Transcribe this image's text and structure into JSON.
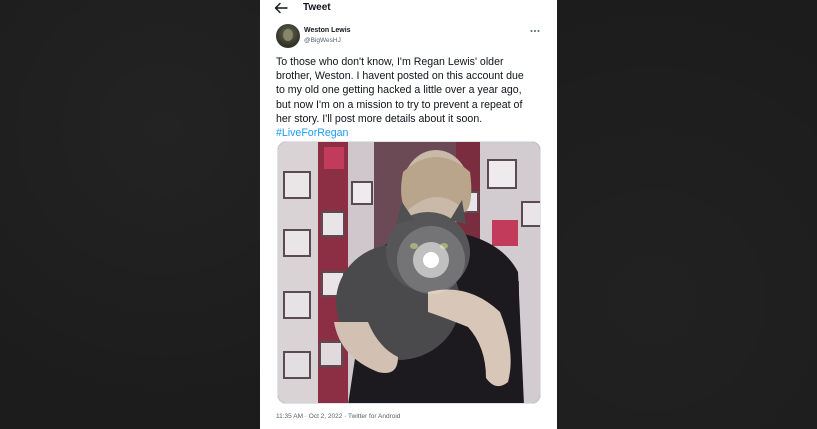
{
  "header": {
    "title": "Tweet",
    "back_icon": "arrow-left-icon"
  },
  "author": {
    "display_name": "Weston Lewis",
    "handle": "@BigWesHJ",
    "more_icon": "more-horizontal-icon"
  },
  "tweet": {
    "text_lines": [
      "To those who don't know, I'm Regan Lewis' older",
      "brother, Weston. I havent posted on this account due",
      "to my old one getting hacked a little over a year ago,",
      "but now I'm on a mission to try to prevent a repeat of",
      "her story. I'll post more details about it soon."
    ],
    "hashtag": "#LiveForRegan"
  },
  "media": {
    "description": "photo-of-girl-holding-cat"
  },
  "meta": {
    "time_date_source": "11:35 AM · Oct 2, 2022 · Twitter for Android"
  },
  "colors": {
    "background": "#1c1c1c",
    "card": "#ffffff",
    "text": "#0f1419",
    "secondary": "#536471",
    "link": "#1d9bf0"
  }
}
